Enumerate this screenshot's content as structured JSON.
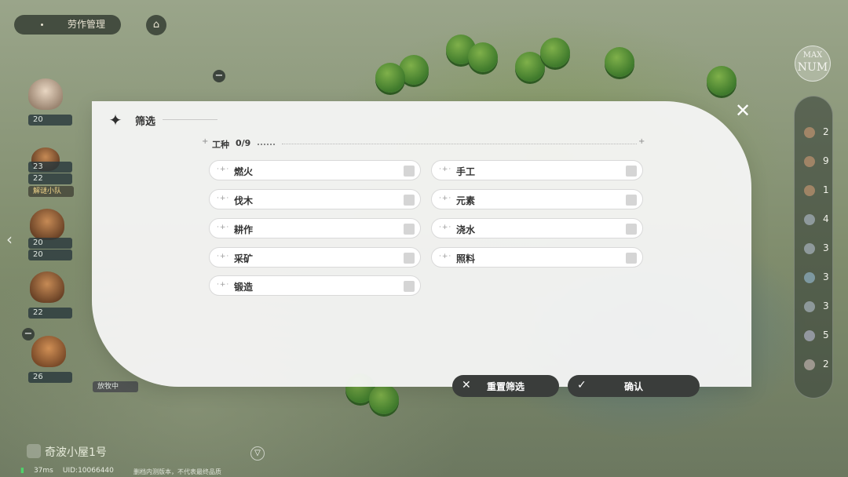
{
  "hud": {
    "labor_management": "劳作管理",
    "team_badge": "解谜小队",
    "grazing_badge": "放牧中",
    "house_name": "奇波小屋1号",
    "ping": "37ms",
    "uid": "UID:10066440",
    "notice": "删档内测版本，不代表最终品质",
    "max_num_top": "MAX",
    "max_num_bottom": "NUM"
  },
  "left_units": [
    {
      "value": "20"
    },
    {
      "value": "23"
    },
    {
      "value": "22"
    },
    {
      "value": "20"
    },
    {
      "value": "20"
    },
    {
      "value": "22"
    },
    {
      "value": "26"
    }
  ],
  "right_counts": [
    "2",
    "9",
    "1",
    "4",
    "3",
    "3",
    "3",
    "5",
    "2"
  ],
  "filter": {
    "title": "筛选",
    "section_label": "工种",
    "section_count": "0/9",
    "options": [
      {
        "label": "燃火",
        "checked": false
      },
      {
        "label": "手工",
        "checked": false
      },
      {
        "label": "伐木",
        "checked": false
      },
      {
        "label": "元素",
        "checked": false
      },
      {
        "label": "耕作",
        "checked": false
      },
      {
        "label": "浇水",
        "checked": false
      },
      {
        "label": "采矿",
        "checked": false
      },
      {
        "label": "照料",
        "checked": false
      },
      {
        "label": "锻造",
        "checked": false
      }
    ],
    "reset_label": "重置筛选",
    "confirm_label": "确认"
  },
  "colors": {
    "modal_bg": "#f6f6f6",
    "button_bg": "#3a3d3b",
    "ping_green": "#4ed36a"
  }
}
